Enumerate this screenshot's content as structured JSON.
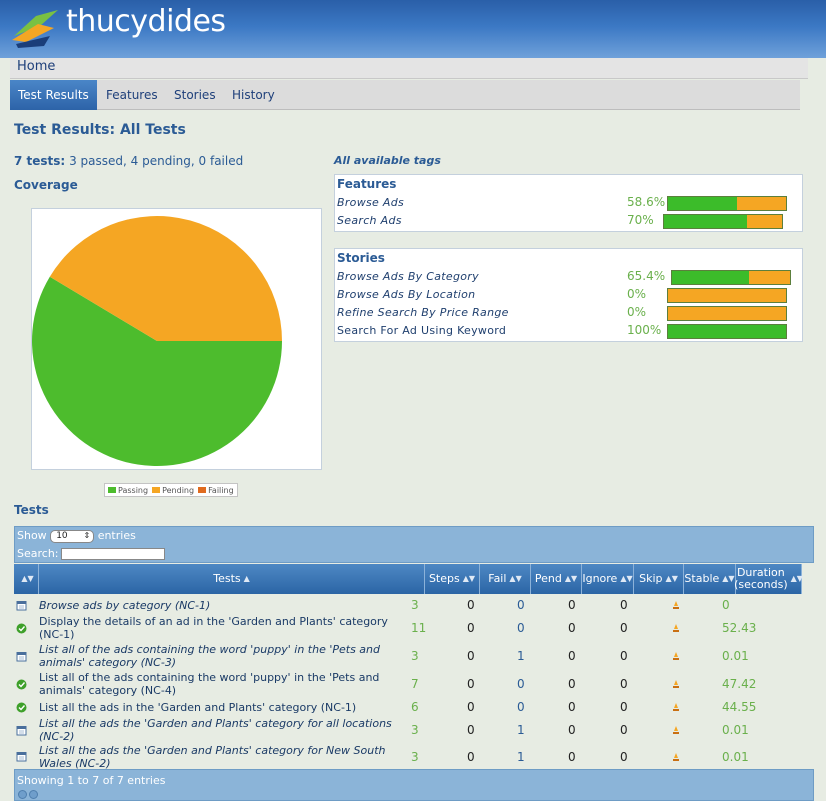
{
  "app": {
    "logo_text": "thucydides"
  },
  "nav": {
    "home": "Home",
    "tabs": [
      {
        "label": "Test Results",
        "active": true
      },
      {
        "label": "Features"
      },
      {
        "label": "Stories"
      },
      {
        "label": "History"
      }
    ]
  },
  "page": {
    "title": "Test Results: All Tests",
    "summary": {
      "count": "7 tests:",
      "passed": "3 passed",
      "pending": "4 pending",
      "failed": "0 failed"
    },
    "coverage_title": "Coverage"
  },
  "chart_data": {
    "type": "pie",
    "slices": [
      {
        "label": "Passing",
        "value": 58.6,
        "color": "#4dbc2d"
      },
      {
        "label": "Pending",
        "value": 41.4,
        "color": "#f5a623"
      },
      {
        "label": "Failing",
        "value": 0,
        "color": "#e06b1f"
      }
    ],
    "legend": [
      "Passing",
      "Pending",
      "Failing"
    ]
  },
  "tags": {
    "title": "All available tags",
    "features": {
      "title": "Features",
      "items": [
        {
          "name": "Browse Ads",
          "percent": "58.6%",
          "fraction": 0.586
        },
        {
          "name": "Search Ads",
          "percent": "70%",
          "fraction": 0.7
        }
      ]
    },
    "stories": {
      "title": "Stories",
      "items": [
        {
          "name": "Browse Ads By Category",
          "percent": "65.4%",
          "fraction": 0.654
        },
        {
          "name": "Browse Ads By Location",
          "percent": "0%",
          "fraction": 0
        },
        {
          "name": "Refine Search By Price Range",
          "percent": "0%",
          "fraction": 0
        },
        {
          "name": "Search For Ad Using Keyword",
          "percent": "100%",
          "fraction": 1.0
        }
      ]
    }
  },
  "tests": {
    "title": "Tests",
    "show_label": "Show",
    "entries_value": "10",
    "entries_label": "entries",
    "search_label": "Search:",
    "search_value": "",
    "columns": [
      "Tests",
      "Steps",
      "Fail",
      "Pend",
      "Ignore",
      "Skip",
      "Stable",
      "Duration (seconds)"
    ],
    "rows": [
      {
        "status": "pending",
        "title": "Browse ads by category (NC-1)",
        "steps": "3",
        "fail": "0",
        "pend": "0",
        "ignore": "0",
        "skip": "0",
        "duration": "0"
      },
      {
        "status": "passed",
        "title": "Display the details of an ad in the 'Garden and Plants' category (NC-1)",
        "steps": "11",
        "fail": "0",
        "pend": "0",
        "ignore": "0",
        "skip": "0",
        "duration": "52.43"
      },
      {
        "status": "pending",
        "title": "List all of the ads containing the word 'puppy' in the 'Pets and animals' category (NC-3)",
        "steps": "3",
        "fail": "0",
        "pend": "1",
        "ignore": "0",
        "skip": "0",
        "duration": "0.01"
      },
      {
        "status": "passed",
        "title": "List all of the ads containing the word 'puppy' in the 'Pets and animals' category (NC-4)",
        "steps": "7",
        "fail": "0",
        "pend": "0",
        "ignore": "0",
        "skip": "0",
        "duration": "47.42"
      },
      {
        "status": "passed",
        "title": "List all the ads in the 'Garden and Plants' category (NC-1)",
        "steps": "6",
        "fail": "0",
        "pend": "0",
        "ignore": "0",
        "skip": "0",
        "duration": "44.55"
      },
      {
        "status": "pending",
        "title": "List all the ads the 'Garden and Plants' category for all locations (NC-2)",
        "steps": "3",
        "fail": "0",
        "pend": "1",
        "ignore": "0",
        "skip": "0",
        "duration": "0.01"
      },
      {
        "status": "pending",
        "title": "List all the ads the 'Garden and Plants' category for New South Wales (NC-2)",
        "steps": "3",
        "fail": "0",
        "pend": "1",
        "ignore": "0",
        "skip": "0",
        "duration": "0.01"
      }
    ],
    "footer_info": "Showing 1 to 7 of 7 entries"
  }
}
